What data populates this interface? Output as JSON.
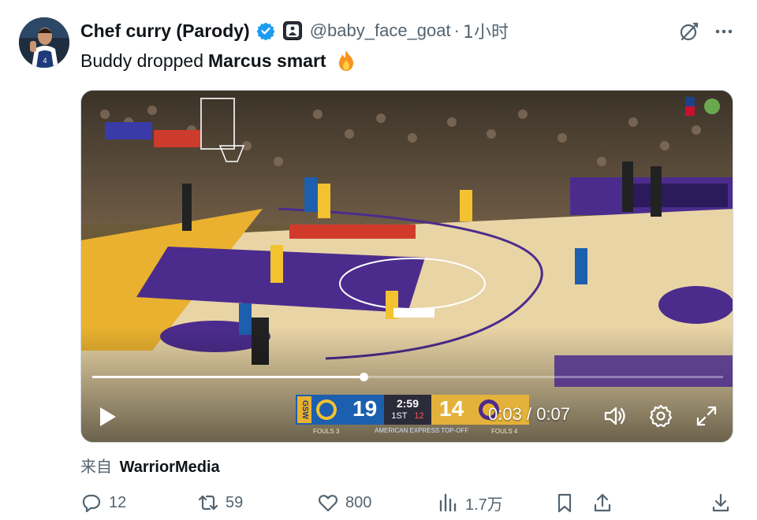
{
  "author": {
    "display_name": "Chef curry (Parody)",
    "handle": "@baby_face_goat",
    "separator": "·",
    "timestamp": "1小时"
  },
  "tweet": {
    "text_plain": "Buddy dropped",
    "text_bold": "Marcus smart",
    "emoji_icon": "fire-icon"
  },
  "video": {
    "current_time": "0:03",
    "separator": "/",
    "duration": "0:07",
    "progress_fraction": 0.43,
    "scorebug": {
      "left_team": "GSW",
      "left_score": "19",
      "clock": "2:59",
      "period": "1ST",
      "shot_clock": "12",
      "right_score": "14",
      "left_fouls": "FOULS 3",
      "right_fouls": "FOULS 4",
      "sponsor": "AMERICAN EXPRESS TOP-OFF"
    }
  },
  "source": {
    "prefix": "来自",
    "account": "WarriorMedia"
  },
  "actions": {
    "replies": "12",
    "reposts": "59",
    "likes": "800",
    "views": "1.7万"
  },
  "colors": {
    "text_primary": "#0f1419",
    "text_secondary": "#536471",
    "verified_blue": "#1d9bf0",
    "court_purple": "#4b2c8c",
    "court_gold": "#e9b12f"
  }
}
